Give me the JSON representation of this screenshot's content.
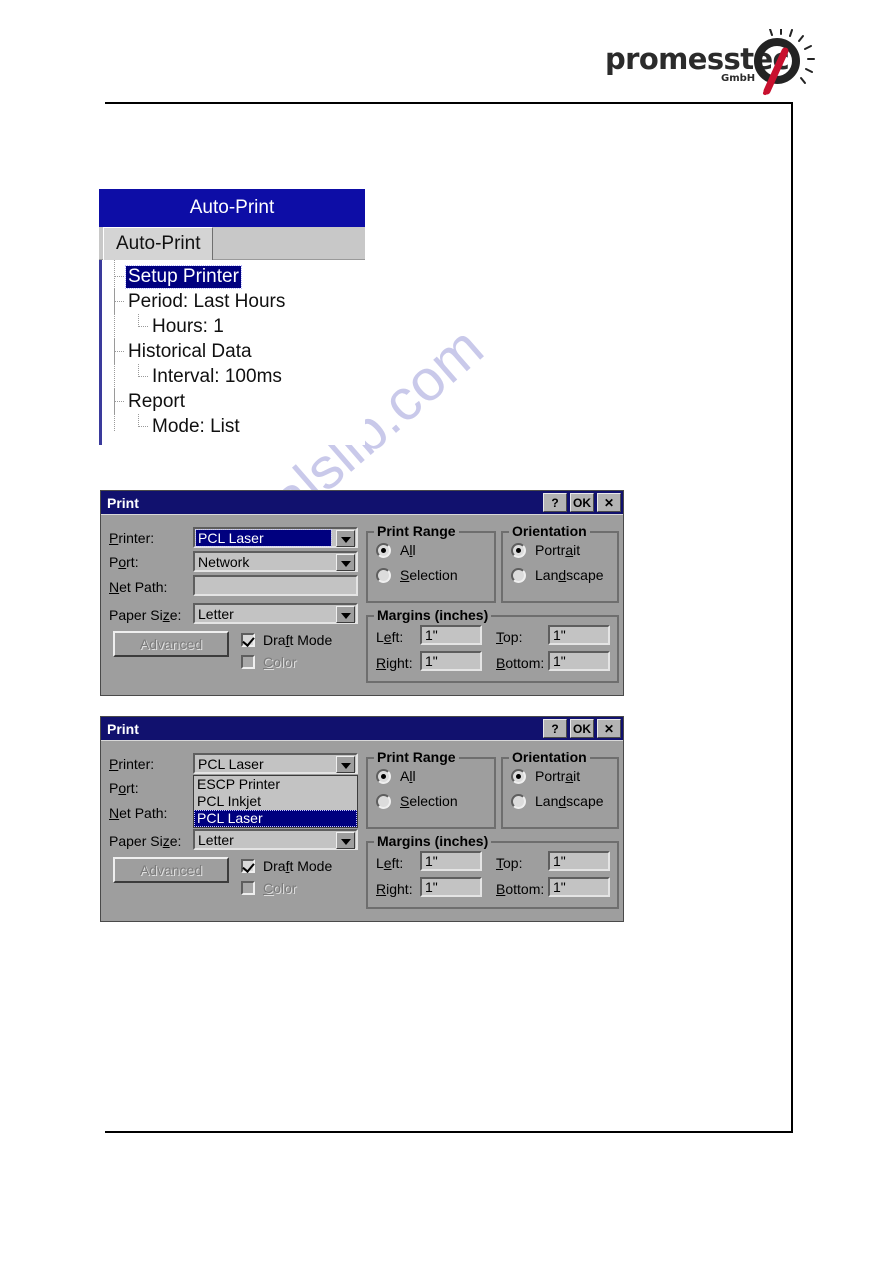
{
  "logo": {
    "word": "promesstec",
    "sub": "GmbH",
    "mark": "p-lightbulb-icon"
  },
  "watermark": {
    "text": "manualslib.com"
  },
  "autoprint_window": {
    "title": "Auto-Print",
    "tab": "Auto-Print",
    "tree": [
      {
        "label": "Setup Printer",
        "depth": 1,
        "selected": true
      },
      {
        "label": "Period: Last Hours",
        "depth": 1,
        "selected": false
      },
      {
        "label": "Hours: 1",
        "depth": 2,
        "selected": false
      },
      {
        "label": "Historical Data",
        "depth": 1,
        "selected": false
      },
      {
        "label": "Interval: 100ms",
        "depth": 2,
        "selected": false
      },
      {
        "label": "Report",
        "depth": 1,
        "selected": false
      },
      {
        "label": "Mode: List",
        "depth": 2,
        "selected": false
      }
    ]
  },
  "print_dialog_1": {
    "title": "Print",
    "buttons": {
      "help": "?",
      "ok": "OK",
      "close": "✕"
    },
    "labels": {
      "printer": "Printer:",
      "port": "Port:",
      "net_path": "Net Path:",
      "paper_size": "Paper Size:",
      "advanced": "Advanced",
      "draft_mode": "Draft Mode",
      "color": "Color"
    },
    "values": {
      "printer": "PCL Laser",
      "port": "Network",
      "net_path": "",
      "paper_size": "Letter"
    },
    "checkboxes": {
      "draft_mode_checked": true,
      "color_checked": false
    },
    "print_range": {
      "title": "Print Range",
      "options": [
        "All",
        "Selection"
      ],
      "selected": "All"
    },
    "orientation": {
      "title": "Orientation",
      "options": [
        "Portrait",
        "Landscape"
      ],
      "selected": "Portrait"
    },
    "margins": {
      "title": "Margins (inches)",
      "left_label": "Left:",
      "left_value": "1\"",
      "top_label": "Top:",
      "top_value": "1\"",
      "right_label": "Right:",
      "right_value": "1\"",
      "bottom_label": "Bottom:",
      "bottom_value": "1\""
    }
  },
  "print_dialog_2": {
    "title": "Print",
    "buttons": {
      "help": "?",
      "ok": "OK",
      "close": "✕"
    },
    "labels": {
      "printer": "Printer:",
      "port": "Port:",
      "net_path": "Net Path:",
      "paper_size": "Paper Size:",
      "advanced": "Advanced",
      "draft_mode": "Draft Mode",
      "color": "Color"
    },
    "values": {
      "printer": "PCL Laser",
      "port": "",
      "net_path": "",
      "paper_size": "Letter"
    },
    "printer_dropdown": {
      "open": true,
      "items": [
        "ESCP Printer",
        "PCL Inkjet",
        "PCL Laser"
      ],
      "selected": "PCL Laser"
    },
    "checkboxes": {
      "draft_mode_checked": true,
      "color_checked": false
    },
    "print_range": {
      "title": "Print Range",
      "options": [
        "All",
        "Selection"
      ],
      "selected": "All"
    },
    "orientation": {
      "title": "Orientation",
      "options": [
        "Portrait",
        "Landscape"
      ],
      "selected": "Portrait"
    },
    "margins": {
      "title": "Margins (inches)",
      "left_label": "Left:",
      "left_value": "1\"",
      "top_label": "Top:",
      "top_value": "1\"",
      "right_label": "Right:",
      "right_value": "1\"",
      "bottom_label": "Bottom:",
      "bottom_value": "1\""
    }
  },
  "colors": {
    "titlebar_autoprint": "#0d0da6",
    "titlebar_print": "#11116e",
    "selection": "#00007f",
    "dialog_face": "#9e9e9e",
    "field_face": "#c3c3c3",
    "watermark": "#c9c9ea",
    "logo_red": "#c8102e"
  }
}
